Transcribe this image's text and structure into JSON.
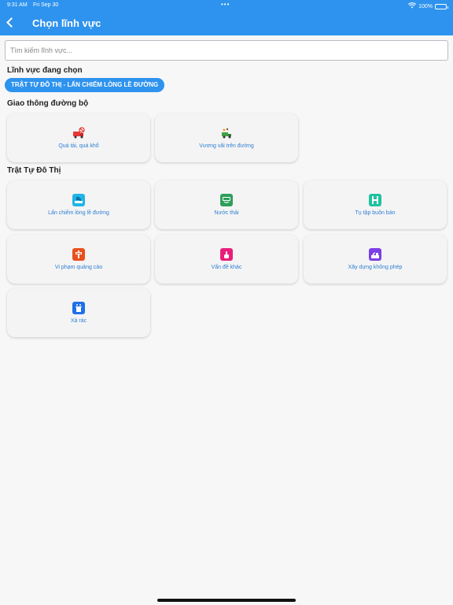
{
  "status_bar": {
    "time": "9:31 AM",
    "date": "Fri Sep 30",
    "battery": "100%"
  },
  "header": {
    "title": "Chọn lĩnh vực"
  },
  "search": {
    "placeholder": "Tìm kiếm lĩnh vực..."
  },
  "selected": {
    "heading": "Lĩnh vực đang chọn",
    "chip": "TRẬT TỰ ĐÔ THỊ - LẤN CHIẾM LÒNG LỀ ĐƯỜNG"
  },
  "sections": [
    {
      "title": "Giao thông đường bộ",
      "items": [
        {
          "label": "Quá tải, quá khổ",
          "icon": "overloaded-truck-icon",
          "color": "#e53935"
        },
        {
          "label": "Vương vãi trên đường",
          "icon": "spilled-cargo-truck-icon",
          "color": "#43a047"
        }
      ]
    },
    {
      "title": "Trật Tự Đô Thị",
      "items": [
        {
          "label": "Lấn chiếm lòng lề đường",
          "icon": "sidewalk-encroachment-icon",
          "color": "#1fb5e8"
        },
        {
          "label": "Nước thải",
          "icon": "wastewater-icon",
          "color": "#2e9e5b"
        },
        {
          "label": "Tụ tập buôn bán",
          "icon": "street-vendor-icon",
          "color": "#1fc2a0"
        },
        {
          "label": "Vi phạm quảng cáo",
          "icon": "illegal-advertising-icon",
          "color": "#e8501e"
        },
        {
          "label": "Vấn đề khác",
          "icon": "other-issue-icon",
          "color": "#e91e7a"
        },
        {
          "label": "Xây dựng không phép",
          "icon": "unpermitted-construction-icon",
          "color": "#7b3fe4"
        },
        {
          "label": "Xả rác",
          "icon": "littering-icon",
          "color": "#1e6fe8"
        }
      ]
    }
  ]
}
